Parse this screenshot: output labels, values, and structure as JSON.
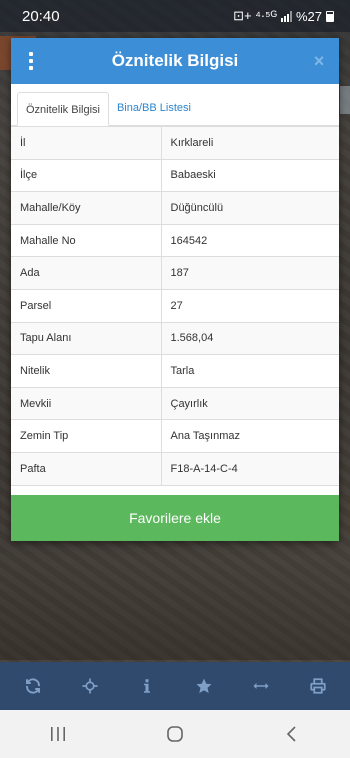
{
  "status_bar": {
    "time": "20:40",
    "indicators": "⊡+ ⁴·⁵ᴳ",
    "battery_text": "%27"
  },
  "dialog": {
    "title": "Öznitelik Bilgisi",
    "close_glyph": "×",
    "tabs": [
      {
        "label": "Öznitelik Bilgisi",
        "active": true
      },
      {
        "label": "Bina/BB Listesi",
        "active": false
      }
    ],
    "rows": [
      {
        "key": "İl",
        "value": "Kırklareli"
      },
      {
        "key": "İlçe",
        "value": "Babaeski"
      },
      {
        "key": "Mahalle/Köy",
        "value": "Düğüncülü"
      },
      {
        "key": "Mahalle No",
        "value": "164542"
      },
      {
        "key": "Ada",
        "value": "187"
      },
      {
        "key": "Parsel",
        "value": "27"
      },
      {
        "key": "Tapu Alanı",
        "value": "1.568,04"
      },
      {
        "key": "Nitelik",
        "value": "Tarla"
      },
      {
        "key": "Mevkii",
        "value": "Çayırlık"
      },
      {
        "key": "Zemin Tip",
        "value": "Ana Taşınmaz"
      },
      {
        "key": "Pafta",
        "value": "F18-A-14-C-4"
      }
    ],
    "favorite_button_label": "Favorilere ekle"
  },
  "toolbar": {
    "icons": [
      "refresh-icon",
      "locate-icon",
      "info-icon",
      "star-icon",
      "measure-icon",
      "print-icon"
    ]
  },
  "navbar": {
    "icons": [
      "recent-apps-icon",
      "home-icon",
      "back-icon"
    ]
  },
  "colors": {
    "header_blue": "#3c8fd6",
    "tab_link_blue": "#2d86d0",
    "favorite_green": "#5cb85c",
    "toolbar_navy": "#2f4a6d",
    "toolbar_icon": "#7f9fc7"
  }
}
